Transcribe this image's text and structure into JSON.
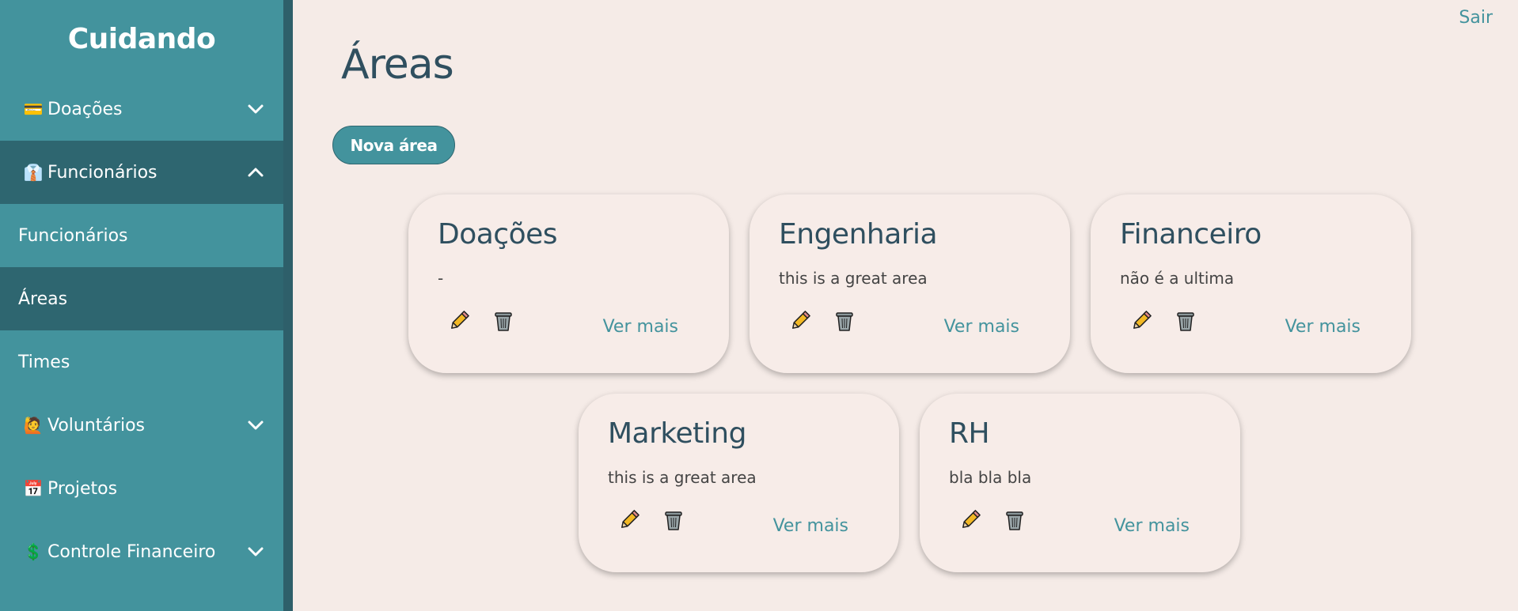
{
  "brand": "Cuidando",
  "logout_label": "Sair",
  "page_title": "Áreas",
  "new_button_label": "Nova área",
  "more_label": "Ver mais",
  "sidebar": {
    "items": [
      {
        "emoji": "💳",
        "label": "Doações",
        "chevron": "down"
      },
      {
        "emoji": "👔",
        "label": "Funcionários",
        "chevron": "up"
      },
      {
        "label": "Funcionários"
      },
      {
        "label": "Áreas"
      },
      {
        "label": "Times"
      },
      {
        "emoji": "🙋",
        "label": "Voluntários",
        "chevron": "down"
      },
      {
        "emoji": "📅",
        "label": "Projetos"
      },
      {
        "emoji": "💲",
        "label": "Controle Financeiro",
        "chevron": "down"
      }
    ]
  },
  "cards": [
    {
      "title": "Doações",
      "desc": "-"
    },
    {
      "title": "Engenharia",
      "desc": "this is a great area"
    },
    {
      "title": "Financeiro",
      "desc": "não é a ultima"
    },
    {
      "title": "Marketing",
      "desc": "this is a great area"
    },
    {
      "title": "RH",
      "desc": "bla bla bla"
    }
  ],
  "colors": {
    "accent": "#43939d",
    "accent_dark": "#2e6670",
    "background": "#f5ebe7",
    "title": "#2f4f5f"
  },
  "icons": {
    "edit": "pencil-icon",
    "delete": "trash-icon",
    "expand": "chevron-down-icon",
    "collapse": "chevron-up-icon"
  }
}
